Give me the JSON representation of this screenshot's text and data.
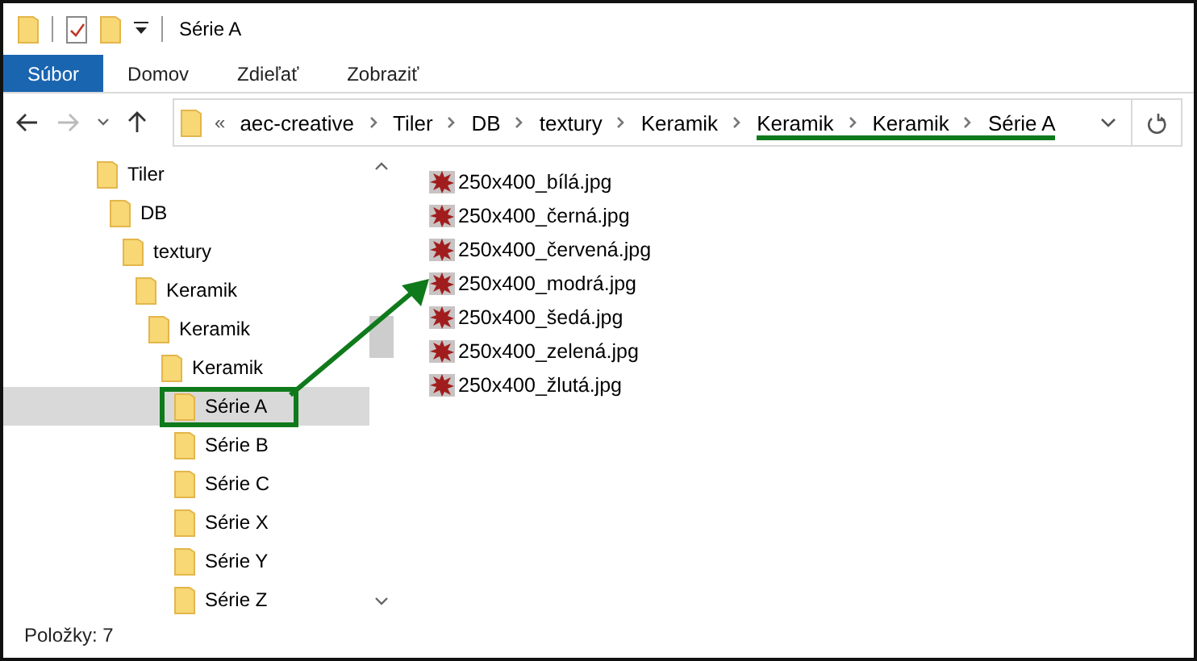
{
  "window": {
    "title": "Série A"
  },
  "ribbon_tabs": [
    {
      "label": "Súbor",
      "selected": true
    },
    {
      "label": "Domov",
      "selected": false
    },
    {
      "label": "Zdieľať",
      "selected": false
    },
    {
      "label": "Zobraziť",
      "selected": false
    }
  ],
  "address_bar": {
    "overflow": "«",
    "crumbs": [
      {
        "label": "aec-creative",
        "highlighted": false
      },
      {
        "label": "Tiler",
        "highlighted": false
      },
      {
        "label": "DB",
        "highlighted": false
      },
      {
        "label": "textury",
        "highlighted": false
      },
      {
        "label": "Keramik",
        "highlighted": false
      },
      {
        "label": "Keramik",
        "highlighted": true
      },
      {
        "label": "Keramik",
        "highlighted": true
      },
      {
        "label": "Série A",
        "highlighted": true
      }
    ]
  },
  "navigation_tree": [
    {
      "label": "Tiler",
      "selected": false,
      "highlighted": false,
      "children": [
        {
          "label": "DB",
          "selected": false,
          "highlighted": false,
          "children": [
            {
              "label": "textury",
              "selected": false,
              "highlighted": false,
              "children": [
                {
                  "label": "Keramik",
                  "selected": false,
                  "highlighted": false,
                  "children": [
                    {
                      "label": "Keramik",
                      "selected": false,
                      "highlighted": false,
                      "children": [
                        {
                          "label": "Keramik",
                          "selected": false,
                          "highlighted": false,
                          "children": [
                            {
                              "label": "Série A",
                              "selected": true,
                              "highlighted": true
                            },
                            {
                              "label": "Série B",
                              "selected": false,
                              "highlighted": false
                            },
                            {
                              "label": "Série C",
                              "selected": false,
                              "highlighted": false
                            },
                            {
                              "label": "Série X",
                              "selected": false,
                              "highlighted": false
                            },
                            {
                              "label": "Série Y",
                              "selected": false,
                              "highlighted": false
                            },
                            {
                              "label": "Série Z",
                              "selected": false,
                              "highlighted": false
                            }
                          ]
                        }
                      ]
                    }
                  ]
                }
              ]
            }
          ]
        }
      ]
    }
  ],
  "files": [
    "250x400_bílá.jpg",
    "250x400_černá.jpg",
    "250x400_červená.jpg",
    "250x400_modrá.jpg",
    "250x400_šedá.jpg",
    "250x400_zelená.jpg",
    "250x400_žlutá.jpg"
  ],
  "status_bar": {
    "item_count": "Položky: 7"
  }
}
